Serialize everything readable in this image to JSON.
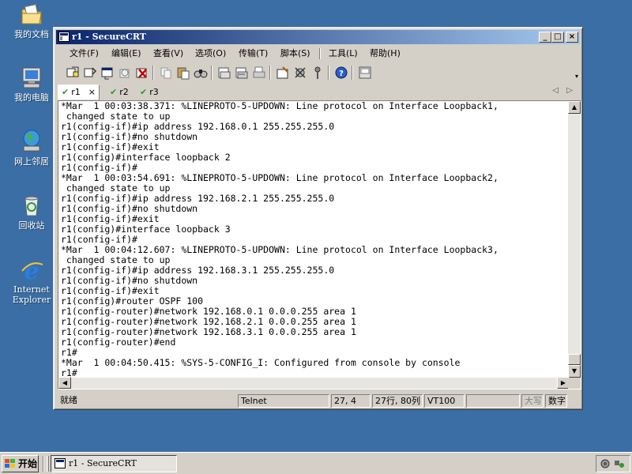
{
  "desktop": {
    "icons": [
      {
        "label": "我的文档",
        "icon": "my-documents-icon"
      },
      {
        "label": "我的电脑",
        "icon": "my-computer-icon"
      },
      {
        "label": "网上邻居",
        "icon": "network-places-icon"
      },
      {
        "label": "回收站",
        "icon": "recycle-bin-icon"
      },
      {
        "label": "Internet Explorer",
        "icon": "internet-explorer-icon"
      }
    ]
  },
  "window": {
    "title": "r1 - SecureCRT",
    "controls": {
      "minimize": "_",
      "maximize": "□",
      "close": "×"
    }
  },
  "menu": {
    "items": [
      "文件(F)",
      "编辑(E)",
      "查看(V)",
      "选项(O)",
      "传输(T)",
      "脚本(S)",
      "工具(L)",
      "帮助(H)"
    ]
  },
  "toolbar": {
    "icons": [
      "connect-icon",
      "quick-connect-icon",
      "connect-tab-icon",
      "reconnect-icon",
      "disconnect-icon",
      "copy-icon",
      "paste-icon",
      "find-icon",
      "print-icon",
      "print-selection-icon",
      "printer-icon",
      "session-options-icon",
      "global-options-icon",
      "keymap-icon",
      "help-icon",
      "sftp-icon"
    ]
  },
  "tabs": [
    {
      "label": "r1",
      "active": true,
      "close": "×"
    },
    {
      "label": "r2",
      "active": false
    },
    {
      "label": "r3",
      "active": false
    }
  ],
  "tab_nav": {
    "prev": "◁",
    "next": "▷"
  },
  "terminal": {
    "lines": [
      "*Mar  1 00:03:38.371: %LINEPROTO-5-UPDOWN: Line protocol on Interface Loopback1,",
      " changed state to up",
      "r1(config-if)#ip address 192.168.0.1 255.255.255.0",
      "r1(config-if)#no shutdown",
      "r1(config-if)#exit",
      "r1(config)#interface loopback 2",
      "r1(config-if)#",
      "*Mar  1 00:03:54.691: %LINEPROTO-5-UPDOWN: Line protocol on Interface Loopback2,",
      " changed state to up",
      "r1(config-if)#ip address 192.168.2.1 255.255.255.0",
      "r1(config-if)#no shutdown",
      "r1(config-if)#exit",
      "r1(config)#interface loopback 3",
      "r1(config-if)#",
      "*Mar  1 00:04:12.607: %LINEPROTO-5-UPDOWN: Line protocol on Interface Loopback3,",
      " changed state to up",
      "r1(config-if)#ip address 192.168.3.1 255.255.255.0",
      "r1(config-if)#no shutdown",
      "r1(config-if)#exit",
      "r1(config)#router OSPF 100",
      "r1(config-router)#network 192.168.0.1 0.0.0.255 area 1",
      "r1(config-router)#network 192.168.2.1 0.0.0.255 area 1",
      "r1(config-router)#network 192.168.3.1 0.0.0.255 area 1",
      "r1(config-router)#end",
      "r1#",
      "*Mar  1 00:04:50.415: %SYS-5-CONFIG_I: Configured from console by console",
      "r1#"
    ],
    "scroll": {
      "up": "▲",
      "down": "▼",
      "left": "◀",
      "right": "▶"
    }
  },
  "status": {
    "ready": "就绪",
    "protocol": "Telnet",
    "cursor": "27,  4",
    "size": "27行, 80列",
    "emulation": "VT100",
    "caps": "大写",
    "num": "数字"
  },
  "taskbar": {
    "start_label": "开始",
    "task_label": "r1 - SecureCRT",
    "tray_icons": [
      "network-status-icon",
      "volume-icon"
    ]
  },
  "colors": {
    "desktop": "#3a6ea5",
    "title_start": "#0a246a",
    "title_end": "#a6caf0",
    "tab_check": "#2f9a2f"
  }
}
